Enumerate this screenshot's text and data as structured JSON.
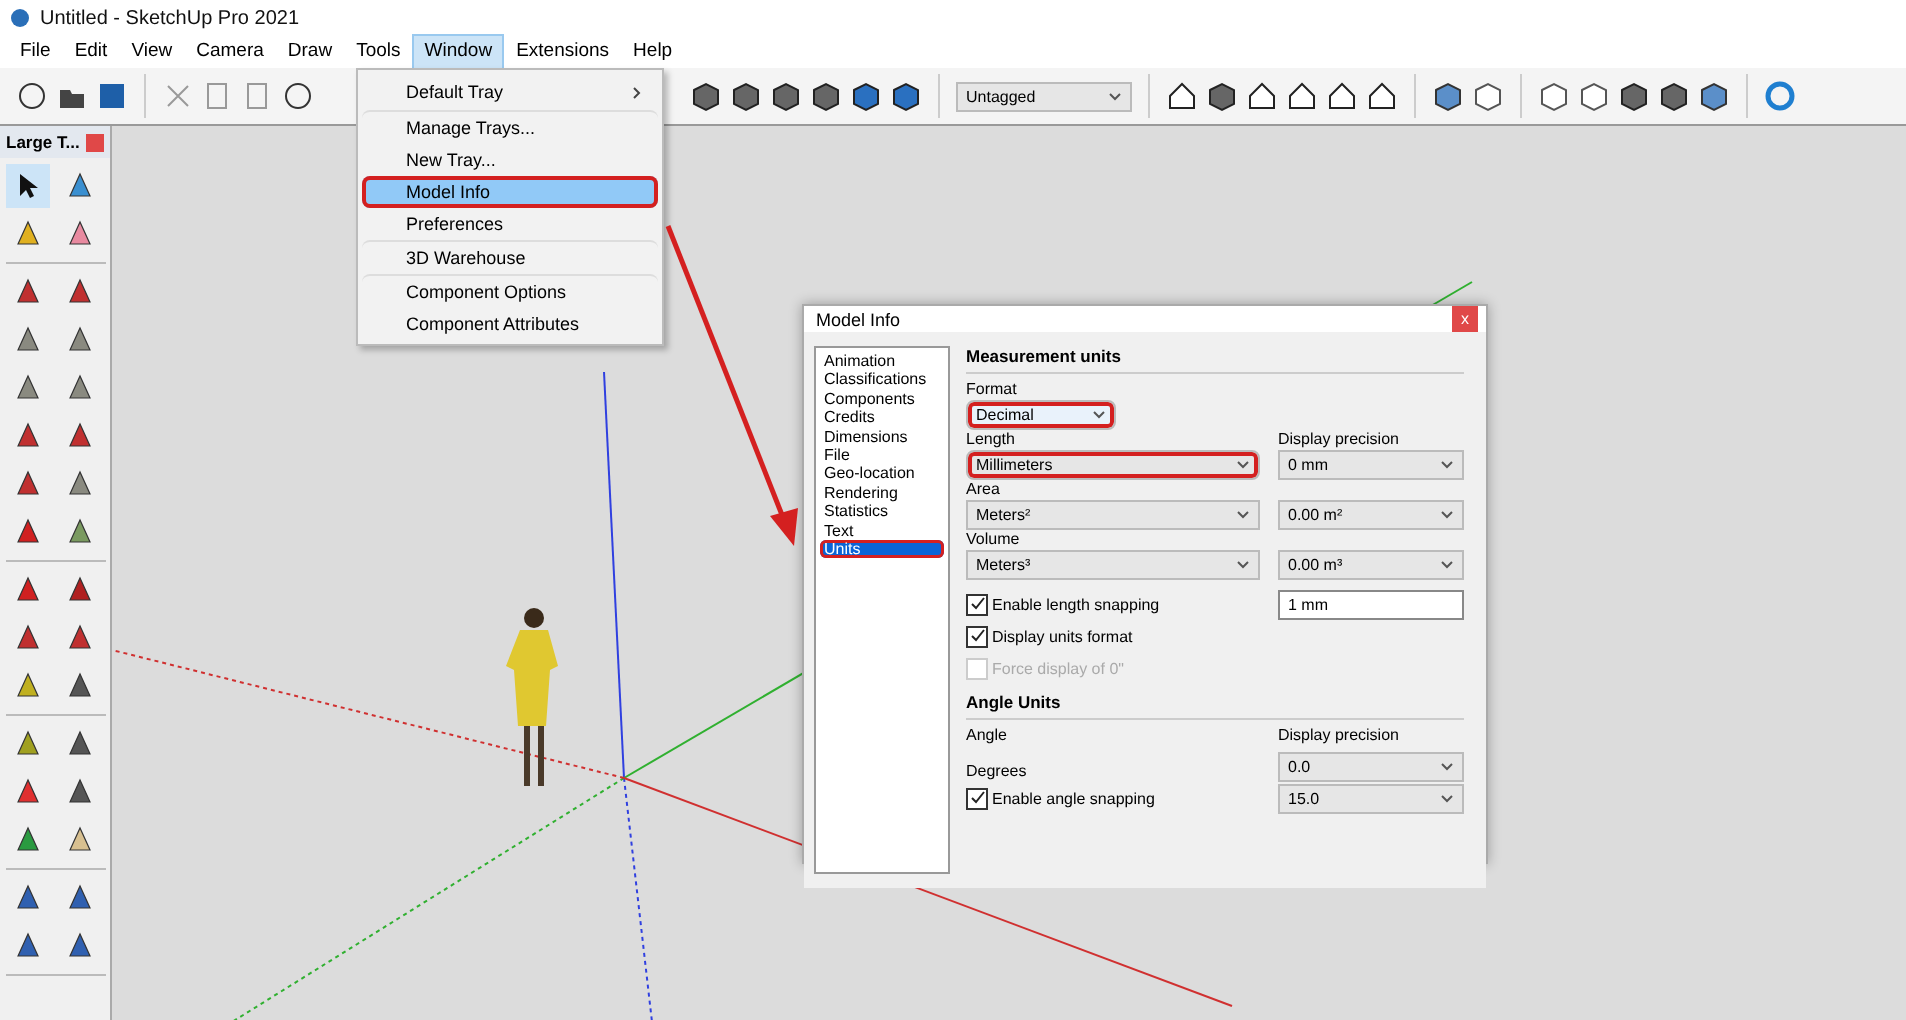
{
  "window": {
    "title": "Untitled - SketchUp Pro 2021"
  },
  "menu": [
    {
      "label": "File",
      "selected": false
    },
    {
      "label": "Edit",
      "selected": false
    },
    {
      "label": "View",
      "selected": false
    },
    {
      "label": "Camera",
      "selected": false
    },
    {
      "label": "Draw",
      "selected": false
    },
    {
      "label": "Tools",
      "selected": false
    },
    {
      "label": "Window",
      "selected": true
    },
    {
      "label": "Extensions",
      "selected": false
    },
    {
      "label": "Help",
      "selected": false
    }
  ],
  "window_menu": [
    {
      "label": "Default Tray",
      "submenu": true,
      "selected": false,
      "highlighted": false
    },
    {
      "label": "Manage Trays...",
      "submenu": false,
      "selected": false,
      "highlighted": false
    },
    {
      "label": "New Tray...",
      "submenu": false,
      "selected": false,
      "highlighted": false
    },
    {
      "label": "Model Info",
      "submenu": false,
      "selected": true,
      "highlighted": true
    },
    {
      "label": "Preferences",
      "submenu": false,
      "selected": false,
      "highlighted": false
    },
    {
      "label": "3D Warehouse",
      "submenu": false,
      "selected": false,
      "highlighted": false
    },
    {
      "label": "Component Options",
      "submenu": false,
      "selected": false,
      "highlighted": false
    },
    {
      "label": "Component Attributes",
      "submenu": false,
      "selected": false,
      "highlighted": false
    }
  ],
  "tag_dropdown": {
    "value": "Untagged"
  },
  "tray": {
    "title": "Large T..."
  },
  "dialog": {
    "title": "Model Info",
    "close_label": "x",
    "categories": [
      {
        "label": "Animation",
        "selected": false,
        "highlighted": false
      },
      {
        "label": "Classifications",
        "selected": false,
        "highlighted": false
      },
      {
        "label": "Components",
        "selected": false,
        "highlighted": false
      },
      {
        "label": "Credits",
        "selected": false,
        "highlighted": false
      },
      {
        "label": "Dimensions",
        "selected": false,
        "highlighted": false
      },
      {
        "label": "File",
        "selected": false,
        "highlighted": false
      },
      {
        "label": "Geo-location",
        "selected": false,
        "highlighted": false
      },
      {
        "label": "Rendering",
        "selected": false,
        "highlighted": false
      },
      {
        "label": "Statistics",
        "selected": false,
        "highlighted": false
      },
      {
        "label": "Text",
        "selected": false,
        "highlighted": false
      },
      {
        "label": "Units",
        "selected": true,
        "highlighted": true
      }
    ],
    "measurement": {
      "heading": "Measurement units",
      "format_label": "Format",
      "format": "Decimal",
      "format_highlighted": true,
      "length_label": "Length",
      "length": "Millimeters",
      "length_highlighted": true,
      "precision_label": "Display precision",
      "length_precision": "0 mm",
      "area_label": "Area",
      "area": "Meters²",
      "area_precision": "0.00 m²",
      "volume_label": "Volume",
      "volume": "Meters³",
      "volume_precision": "0.00 m³",
      "options": [
        {
          "label": "Enable length snapping",
          "checked": true,
          "disabled": false,
          "value": "1 mm"
        },
        {
          "label": "Display units format",
          "checked": true,
          "disabled": false
        },
        {
          "label": "Force display of 0\"",
          "checked": false,
          "disabled": true
        }
      ]
    },
    "angle": {
      "heading": "Angle Units",
      "angle_label": "Angle",
      "precision_label": "Display precision",
      "unit": "Degrees",
      "precision": "0.0",
      "snapping": {
        "label": "Enable angle snapping",
        "checked": true,
        "disabled": false,
        "value": "15.0"
      }
    }
  }
}
